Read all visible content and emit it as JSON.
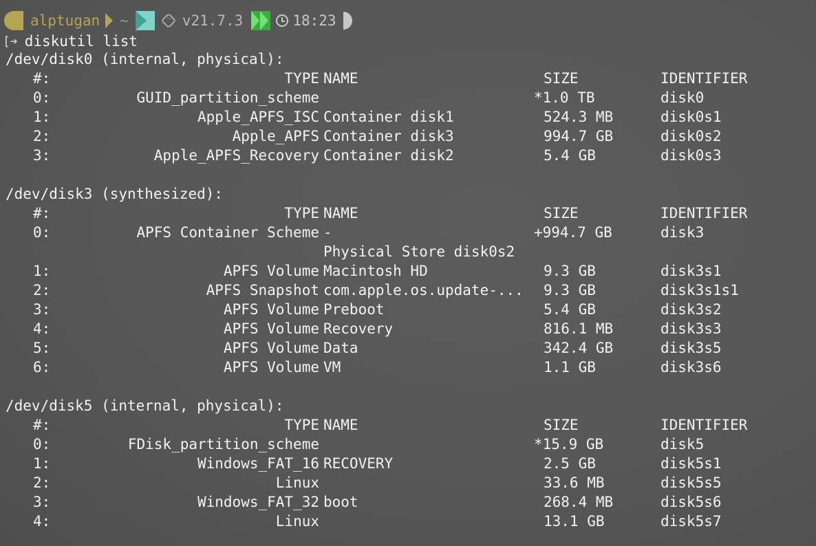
{
  "prompt": {
    "user": "alptugan",
    "dir": "~",
    "node_version": "v21.7.3",
    "time": "18:23",
    "icons": [
      "apple-icon",
      "node-icon",
      "clock-icon"
    ]
  },
  "command": "diskutil list",
  "headers": {
    "idx": "#:",
    "type": "TYPE",
    "name": "NAME",
    "size": "SIZE",
    "identifier": "IDENTIFIER"
  },
  "disks": [
    {
      "title": "/dev/disk0 (internal, physical):",
      "rows": [
        {
          "idx": "0:",
          "type": "GUID_partition_scheme",
          "name": "",
          "size": "*1.0 TB",
          "id": "disk0"
        },
        {
          "idx": "1:",
          "type": "Apple_APFS_ISC",
          "name": "Container disk1",
          "size": "524.3 MB",
          "id": "disk0s1"
        },
        {
          "idx": "2:",
          "type": "Apple_APFS",
          "name": "Container disk3",
          "size": "994.7 GB",
          "id": "disk0s2"
        },
        {
          "idx": "3:",
          "type": "Apple_APFS_Recovery",
          "name": "Container disk2",
          "size": "5.4 GB",
          "id": "disk0s3"
        }
      ]
    },
    {
      "title": "/dev/disk3 (synthesized):",
      "rows": [
        {
          "idx": "0:",
          "type": "APFS Container Scheme",
          "name": "-",
          "size": "+994.7 GB",
          "id": "disk3"
        },
        {
          "idx": "",
          "type": "",
          "name": "Physical Store disk0s2",
          "size": "",
          "id": ""
        },
        {
          "idx": "1:",
          "type": "APFS Volume",
          "name": "Macintosh HD",
          "size": "9.3 GB",
          "id": "disk3s1"
        },
        {
          "idx": "2:",
          "type": "APFS Snapshot",
          "name": "com.apple.os.update-...",
          "size": "9.3 GB",
          "id": "disk3s1s1"
        },
        {
          "idx": "3:",
          "type": "APFS Volume",
          "name": "Preboot",
          "size": "5.4 GB",
          "id": "disk3s2"
        },
        {
          "idx": "4:",
          "type": "APFS Volume",
          "name": "Recovery",
          "size": "816.1 MB",
          "id": "disk3s3"
        },
        {
          "idx": "5:",
          "type": "APFS Volume",
          "name": "Data",
          "size": "342.4 GB",
          "id": "disk3s5"
        },
        {
          "idx": "6:",
          "type": "APFS Volume",
          "name": "VM",
          "size": "1.1 GB",
          "id": "disk3s6"
        }
      ]
    },
    {
      "title": "/dev/disk5 (internal, physical):",
      "rows": [
        {
          "idx": "0:",
          "type": "FDisk_partition_scheme",
          "name": "",
          "size": "*15.9 GB",
          "id": "disk5"
        },
        {
          "idx": "1:",
          "type": "Windows_FAT_16",
          "name": "RECOVERY",
          "size": "2.5 GB",
          "id": "disk5s1"
        },
        {
          "idx": "2:",
          "type": "Linux",
          "name": "",
          "size": "33.6 MB",
          "id": "disk5s5"
        },
        {
          "idx": "3:",
          "type": "Windows_FAT_32",
          "name": "boot",
          "size": "268.4 MB",
          "id": "disk5s6"
        },
        {
          "idx": "4:",
          "type": "Linux",
          "name": "",
          "size": "13.1 GB",
          "id": "disk5s7"
        }
      ]
    }
  ]
}
